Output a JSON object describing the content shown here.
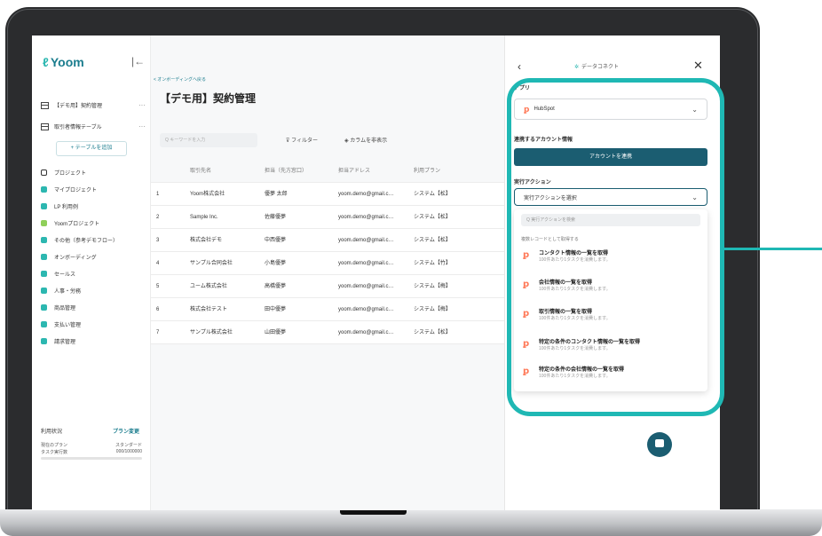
{
  "sidebar": {
    "logo": "Yoom",
    "tables": [
      {
        "label": "【デモ用】契約管理"
      },
      {
        "label": "取引者情報テーブル"
      }
    ],
    "add_table": "+ テーブルを追加",
    "nav": [
      {
        "label": "プロジェクト",
        "color": "#333333"
      },
      {
        "label": "マイプロジェクト",
        "color": "#2cb7b0"
      },
      {
        "label": "LP 利用例",
        "color": "#2cb7b0"
      },
      {
        "label": "Yoomプロジェクト",
        "color": "#8fcf5a"
      },
      {
        "label": "その他（参考デモフロー）",
        "color": "#2cb7b0"
      },
      {
        "label": "オンボーディング",
        "color": "#2cb7b0"
      },
      {
        "label": "セールス",
        "color": "#2cb7b0"
      },
      {
        "label": "人事・労務",
        "color": "#2cb7b0"
      },
      {
        "label": "商品管理",
        "color": "#2cb7b0"
      },
      {
        "label": "支払い管理",
        "color": "#2cb7b0"
      },
      {
        "label": "請求管理",
        "color": "#2cb7b0"
      }
    ],
    "usage": {
      "title": "利用状況",
      "plan_change": "プラン変更",
      "rows": [
        {
          "label": "現在のプラン",
          "value": "スタンダード"
        },
        {
          "label": "タスク実行数",
          "value": "000/1000000"
        }
      ]
    }
  },
  "main": {
    "back_link": "< オンボーディングへ戻る",
    "title": "【デモ用】契約管理",
    "search_placeholder": "Q キーワードを入力",
    "filter": "フィルター",
    "hide_columns": "カラムを非表示",
    "columns": [
      "取引先名",
      "担当（先方窓口）",
      "担当アドレス",
      "利用プラン"
    ],
    "rows": [
      {
        "no": "1",
        "company": "Yoom株式会社",
        "contact": "優夢 太郎",
        "email": "yoom.demo@gmail.c…",
        "plan": "システム【松】"
      },
      {
        "no": "2",
        "company": "Sample Inc.",
        "contact": "佐藤優夢",
        "email": "yoom.demo@gmail.c…",
        "plan": "システム【松】"
      },
      {
        "no": "3",
        "company": "株式会社デモ",
        "contact": "中西優夢",
        "email": "yoom.demo@gmail.c…",
        "plan": "システム【松】"
      },
      {
        "no": "4",
        "company": "サンプル合同会社",
        "contact": "小島優夢",
        "email": "yoom.demo@gmail.c…",
        "plan": "システム【竹】"
      },
      {
        "no": "5",
        "company": "ユーム株式会社",
        "contact": "高橋優夢",
        "email": "yoom.demo@gmail.c…",
        "plan": "システム【梅】"
      },
      {
        "no": "6",
        "company": "株式会社テスト",
        "contact": "田中優夢",
        "email": "yoom.demo@gmail.c…",
        "plan": "システム【梅】"
      },
      {
        "no": "7",
        "company": "サンプル株式会社",
        "contact": "山田優夢",
        "email": "yoom.demo@gmail.c…",
        "plan": "システム【松】"
      }
    ]
  },
  "panel": {
    "title": "データコネクト",
    "app_label": "アプリ",
    "app_value": "HubSpot",
    "account_label": "連携するアカウント情報",
    "connect_button": "アカウントを連携",
    "action_label": "実行アクション",
    "action_select": "実行アクションを選択",
    "dropdown_search": "Q 実行アクションを検索",
    "dropdown_heading": "複数レコードとして取得する",
    "options": [
      {
        "title": "コンタクト情報の一覧を取得",
        "sub": "100件あたり1タスクを消費します。"
      },
      {
        "title": "会社情報の一覧を取得",
        "sub": "100件あたり1タスクを消費します。"
      },
      {
        "title": "取引情報の一覧を取得",
        "sub": "100件あたり1タスクを消費します。"
      },
      {
        "title": "特定の条件のコンタクト情報の一覧を取得",
        "sub": "100件あたり1タスクを消費します。"
      },
      {
        "title": "特定の条件の会社情報の一覧を取得",
        "sub": "100件あたり1タスクを消費します。"
      }
    ]
  },
  "colors": {
    "accent": "#1fb8b4",
    "primary": "#1b5d71",
    "hubspot": "#ff7a59"
  }
}
